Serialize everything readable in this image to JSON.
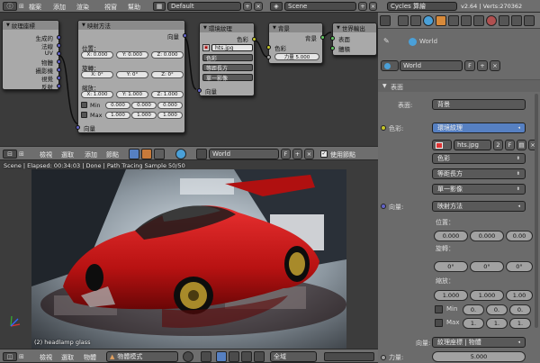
{
  "top_header": {
    "menus": [
      "檔案",
      "添加",
      "渲染",
      "視窗",
      "幫助"
    ],
    "layout": "Default",
    "scene": "Scene",
    "engine": "Cycles 算繪",
    "version": "v2.64 | Verts:270362"
  },
  "node_editor": {
    "nodes": {
      "texcoord": {
        "title": "紋理座標",
        "outputs": [
          "生成的",
          "法線",
          "UV",
          "物體",
          "攝影機",
          "視覺",
          "反射"
        ]
      },
      "mapping": {
        "title": "映射方法",
        "output": "向量",
        "location_label": "位置：",
        "location": [
          "X: 0.000",
          "Y: 0.000",
          "Z: 0.000"
        ],
        "rotation_label": "旋轉：",
        "rotation": [
          "X: 0°",
          "Y: 0°",
          "Z: 0°"
        ],
        "scale_label": "縮放：",
        "scale": [
          "X: 1.000",
          "Y: 1.000",
          "Z: 1.000"
        ],
        "min_label": "Min",
        "min": [
          "0.000",
          "0.000",
          "0.000"
        ],
        "max_label": "Max",
        "max": [
          "1.000",
          "1.000",
          "1.000"
        ],
        "input": "向量"
      },
      "envtex": {
        "title": "環境紋理",
        "output": "色彩",
        "img_field": "hts.jpg",
        "color_space": "色彩",
        "projection": "等距長方",
        "source": "單一影像",
        "input": "向量"
      },
      "background": {
        "title": "背景",
        "output": "背景",
        "color_label": "色彩",
        "strength": "力量 5.000"
      },
      "world_output": {
        "title": "世界輸出",
        "inputs": [
          "表面",
          "體積"
        ]
      }
    }
  },
  "node_header": {
    "menus": [
      "檢視",
      "選取",
      "添加",
      "節點"
    ],
    "world": "World",
    "fake_user": "F",
    "use_nodes": "使用節點"
  },
  "viewport": {
    "status": "Scene | Elapsed: 00:34:03 | Done | Path Tracing Sample 50/50",
    "object_label": "(2) headlamp glass"
  },
  "bottom_header": {
    "menus": [
      "檢視",
      "選取",
      "物體"
    ],
    "mode": "物體模式",
    "pivot": "全域"
  },
  "properties": {
    "breadcrumb": "World",
    "world_name": "World",
    "fake_user": "F",
    "panel_title": "表面",
    "surface_label": "表面:",
    "surface_value": "背景",
    "color_label": "色彩:",
    "color_value": "環境紋理",
    "image_name": "hts.jpg",
    "image_users": "2",
    "image_fake": "F",
    "color_space": "色彩",
    "projection": "等距長方",
    "source": "單一影像",
    "vector_label": "向量:",
    "vector_value": "映射方法",
    "loc_label": "位置：",
    "loc": [
      "0.000",
      "0.000",
      "0.00"
    ],
    "rot_label": "旋轉：",
    "rot": [
      "0°",
      "0°",
      "0°"
    ],
    "scale_label": "縮放：",
    "scale": [
      "1.000",
      "1.000",
      "1.00"
    ],
    "min_label": "Min",
    "min": [
      "0.",
      "0.",
      "0."
    ],
    "max_label": "Max",
    "max": [
      "1.",
      "1.",
      "1."
    ],
    "vector2_label": "向量:",
    "vector2_value": "紋理座標 | 物體",
    "strength_label": "力量:",
    "strength_value": "5.000"
  },
  "colors": {
    "socket_vector": "#6363c7",
    "socket_color": "#c7c729",
    "socket_shader": "#63c763",
    "accent_blue": "#5680c2",
    "car_red": "#c01818"
  }
}
